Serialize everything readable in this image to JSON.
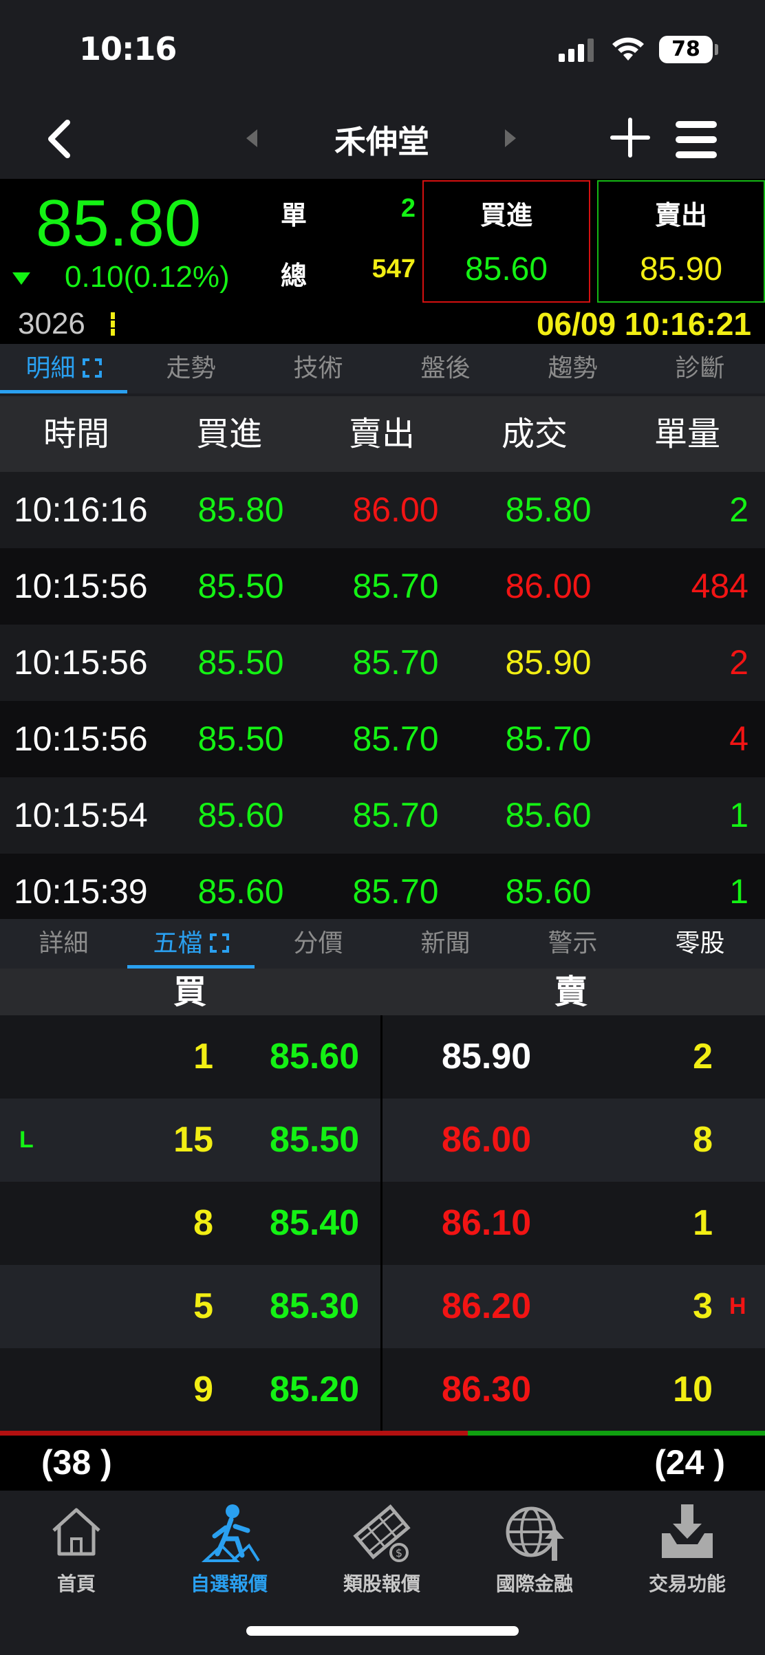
{
  "status": {
    "time": "10:16",
    "battery": "78"
  },
  "nav": {
    "title": "禾伸堂"
  },
  "quote": {
    "price": "85.80",
    "change": "0.10(0.12%)",
    "single_label": "單",
    "single_value": "2",
    "total_label": "總",
    "total_value": "547",
    "bid_label": "買進",
    "bid_value": "85.60",
    "ask_label": "賣出",
    "ask_value": "85.90",
    "code": "3026",
    "datetime": "06/09 10:16:21"
  },
  "top_tabs": [
    "明細",
    "走勢",
    "技術",
    "盤後",
    "趨勢",
    "診斷"
  ],
  "detail": {
    "headers": [
      "時間",
      "買進",
      "賣出",
      "成交",
      "單量"
    ],
    "rows": [
      {
        "time": "10:16:16",
        "bid": "85.80",
        "ask": "86.00",
        "deal": "85.80",
        "vol": "2"
      },
      {
        "time": "10:15:56",
        "bid": "85.50",
        "ask": "85.70",
        "deal": "86.00",
        "vol": "484"
      },
      {
        "time": "10:15:56",
        "bid": "85.50",
        "ask": "85.70",
        "deal": "85.90",
        "vol": "2"
      },
      {
        "time": "10:15:56",
        "bid": "85.50",
        "ask": "85.70",
        "deal": "85.70",
        "vol": "4"
      },
      {
        "time": "10:15:54",
        "bid": "85.60",
        "ask": "85.70",
        "deal": "85.60",
        "vol": "1"
      },
      {
        "time": "10:15:39",
        "bid": "85.60",
        "ask": "85.70",
        "deal": "85.60",
        "vol": "1"
      }
    ]
  },
  "bottom_tabs": [
    "詳細",
    "五檔",
    "分價",
    "新聞",
    "警示",
    "零股"
  ],
  "five": {
    "buy_label": "買",
    "sell_label": "賣",
    "low_mark": "L",
    "high_mark": "H",
    "rows": [
      {
        "bqty": "1",
        "bpx": "85.60",
        "spx": "85.90",
        "sqty": "2"
      },
      {
        "bqty": "15",
        "bpx": "85.50",
        "spx": "86.00",
        "sqty": "8"
      },
      {
        "bqty": "8",
        "bpx": "85.40",
        "spx": "86.10",
        "sqty": "1"
      },
      {
        "bqty": "5",
        "bpx": "85.30",
        "spx": "86.20",
        "sqty": "3"
      },
      {
        "bqty": "9",
        "bpx": "85.20",
        "spx": "86.30",
        "sqty": "10"
      }
    ],
    "total_buy": "(38 )",
    "total_sell": "(24 )",
    "buy_ratio": 0.613
  },
  "bottom_nav": [
    "首頁",
    "自選報價",
    "類股報價",
    "國際金融",
    "交易功能"
  ],
  "colors": {
    "up": "#f21414",
    "down": "#14f214",
    "flat": "#f2ee14",
    "accent": "#2aa0f0"
  },
  "icons": [
    "home-icon",
    "watchlist-icon",
    "sector-icon",
    "globe-icon",
    "trade-icon"
  ]
}
